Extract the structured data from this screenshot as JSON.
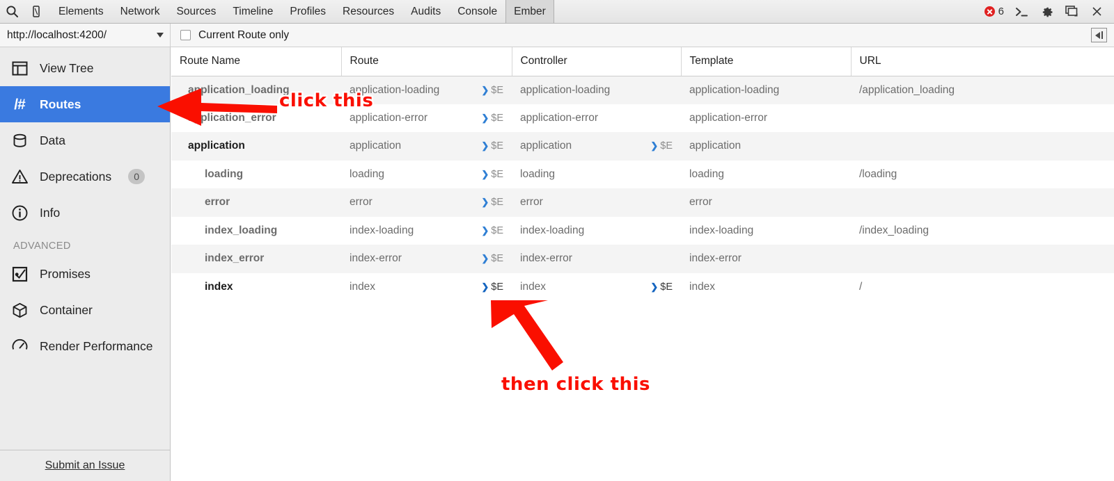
{
  "toolbar": {
    "search_icon": "search-icon",
    "device_icon": "device-toggle-icon",
    "tabs": [
      {
        "label": "Elements",
        "active": false
      },
      {
        "label": "Network",
        "active": false
      },
      {
        "label": "Sources",
        "active": false
      },
      {
        "label": "Timeline",
        "active": false
      },
      {
        "label": "Profiles",
        "active": false
      },
      {
        "label": "Resources",
        "active": false
      },
      {
        "label": "Audits",
        "active": false
      },
      {
        "label": "Console",
        "active": false
      },
      {
        "label": "Ember",
        "active": true
      }
    ],
    "error_count": "6",
    "console_icon": "console-prompt-icon",
    "settings_icon": "gear-icon",
    "dock_icon": "dock-window-icon",
    "close_icon": "close-icon"
  },
  "subbar": {
    "url_value": "http://localhost:4200/",
    "dropdown_icon": "chevron-down-icon",
    "current_route_only_label": "Current Route only",
    "current_route_only_checked": false,
    "collapse_icon": "collapse-panel-icon"
  },
  "sidebar": {
    "items": [
      {
        "label": "View Tree",
        "icon": "view-tree-icon",
        "selected": false,
        "badge": null
      },
      {
        "label": "Routes",
        "icon": "routes-hash-icon",
        "selected": true,
        "badge": null
      },
      {
        "label": "Data",
        "icon": "database-icon",
        "selected": false,
        "badge": null
      },
      {
        "label": "Deprecations",
        "icon": "warning-triangle-icon",
        "selected": false,
        "badge": "0"
      },
      {
        "label": "Info",
        "icon": "info-circle-icon",
        "selected": false,
        "badge": null
      }
    ],
    "section_label": "ADVANCED",
    "advanced_items": [
      {
        "label": "Promises",
        "icon": "promises-icon",
        "selected": false
      },
      {
        "label": "Container",
        "icon": "container-cube-icon",
        "selected": false
      },
      {
        "label": "Render Performance",
        "icon": "gauge-icon",
        "selected": false
      }
    ],
    "footer_link": "Submit an Issue",
    "selected_bg": "#3a7ae0"
  },
  "table": {
    "columns": [
      "Route Name",
      "Route",
      "Controller",
      "Template",
      "URL"
    ],
    "inspect_marker": "$E",
    "rows": [
      {
        "name": "application_loading",
        "indent": 1,
        "strong": false,
        "route": "application-loading",
        "route_inspect": true,
        "controller": "application-loading",
        "controller_inspect": false,
        "template": "application-loading",
        "url": "/application_loading",
        "stripe": true
      },
      {
        "name": "application_error",
        "indent": 1,
        "strong": false,
        "route": "application-error",
        "route_inspect": true,
        "controller": "application-error",
        "controller_inspect": false,
        "template": "application-error",
        "url": "",
        "stripe": false
      },
      {
        "name": "application",
        "indent": 1,
        "strong": true,
        "route": "application",
        "route_inspect": true,
        "controller": "application",
        "controller_inspect": true,
        "template": "application",
        "url": "",
        "stripe": true
      },
      {
        "name": "loading",
        "indent": 2,
        "strong": false,
        "route": "loading",
        "route_inspect": true,
        "controller": "loading",
        "controller_inspect": false,
        "template": "loading",
        "url": "/loading",
        "stripe": false
      },
      {
        "name": "error",
        "indent": 2,
        "strong": false,
        "route": "error",
        "route_inspect": true,
        "controller": "error",
        "controller_inspect": false,
        "template": "error",
        "url": "",
        "stripe": true
      },
      {
        "name": "index_loading",
        "indent": 2,
        "strong": false,
        "route": "index-loading",
        "route_inspect": true,
        "controller": "index-loading",
        "controller_inspect": false,
        "template": "index-loading",
        "url": "/index_loading",
        "stripe": false
      },
      {
        "name": "index_error",
        "indent": 2,
        "strong": false,
        "route": "index-error",
        "route_inspect": true,
        "controller": "index-error",
        "controller_inspect": false,
        "template": "index-error",
        "url": "",
        "stripe": true
      },
      {
        "name": "index",
        "indent": 2,
        "strong": true,
        "route": "index",
        "route_inspect": true,
        "route_inspect_dark": true,
        "controller": "index",
        "controller_inspect": true,
        "controller_inspect_dark": true,
        "template": "index",
        "url": "/",
        "stripe": false
      }
    ]
  },
  "annotations": {
    "color": "#fa0f00",
    "first": {
      "text": "click this"
    },
    "second": {
      "text": "then click this"
    }
  }
}
